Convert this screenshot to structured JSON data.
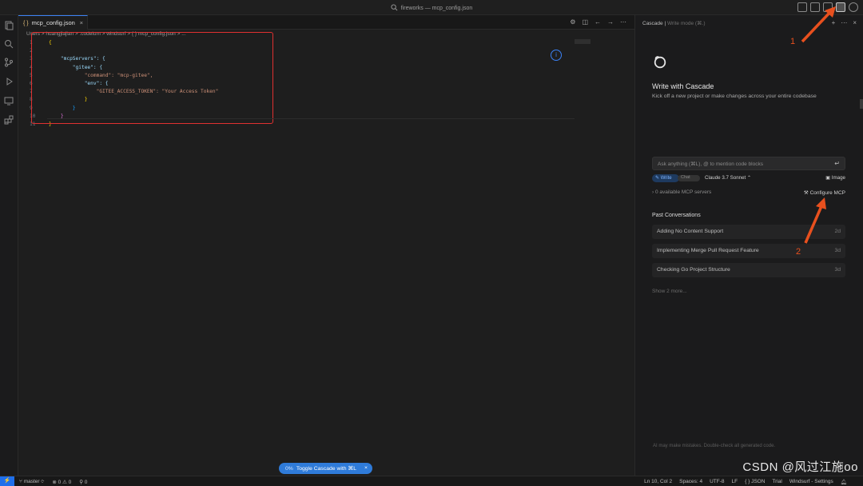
{
  "window": {
    "title": "fireworks — mcp_config.json"
  },
  "editor": {
    "tab_label": "mcp_config.json",
    "tab_icon": "{ }",
    "breadcrumb": "Users > huangjiajian > .codeium > windsurf > { } mcp_config.json > ...",
    "lines": [
      {
        "n": "1",
        "text": "{"
      },
      {
        "n": "2",
        "text": ""
      },
      {
        "n": "3",
        "text": "    \"mcpServers\": {"
      },
      {
        "n": "4",
        "text": "        \"gitee\": {"
      },
      {
        "n": "5",
        "text": "            \"command\": \"mcp-gitee\","
      },
      {
        "n": "6",
        "text": "            \"env\": {"
      },
      {
        "n": "7",
        "text": "                \"GITEE_ACCESS_TOKEN\": \"Your Access Token\""
      },
      {
        "n": "8",
        "text": "            }"
      },
      {
        "n": "9",
        "text": "        }"
      },
      {
        "n": "10",
        "text": "    }"
      },
      {
        "n": "11",
        "text": "}"
      }
    ],
    "toggle_cascade": {
      "percent": "0%",
      "label": "Toggle Cascade with ⌘L"
    }
  },
  "cascade": {
    "header_title": "Cascade",
    "header_mode": "Write mode (⌘.)",
    "welcome_title": "Write with Cascade",
    "welcome_sub": "Kick off a new project or make changes across your entire codebase",
    "input_placeholder": "Ask anything (⌘L), @ to mention code blocks",
    "mode_write": "Write",
    "mode_chat": "Chat",
    "model": "Claude 3.7 Sonnet",
    "image_label": "Image",
    "mcp_servers": "0 available MCP servers",
    "configure_mcp": "Configure MCP",
    "past_title": "Past Conversations",
    "conversations": [
      {
        "title": "Adding No Content Support",
        "age": "2d"
      },
      {
        "title": "Implementing Merge Pull Request Feature",
        "age": "3d"
      },
      {
        "title": "Checking Go Project Structure",
        "age": "3d"
      }
    ],
    "show_more": "Show 2 more...",
    "disclaimer": "AI may make mistakes. Double-check all generated code."
  },
  "annotations": {
    "one": "1",
    "two": "2"
  },
  "statusbar": {
    "branch": "master",
    "problems": "⊗ 0 ⚠ 0",
    "ports": "⚲ 0",
    "cursor": "Ln 10, Col 2",
    "spaces": "Spaces: 4",
    "encoding": "UTF-8",
    "eol": "LF",
    "language": "{ } JSON",
    "trial": "Trial",
    "settings": "Windsurf - Settings"
  },
  "watermark": "CSDN @风过江施oo",
  "colors": {
    "accent": "#2f7bd9",
    "annotation": "#e8501e",
    "highlight_box": "#e03030"
  }
}
